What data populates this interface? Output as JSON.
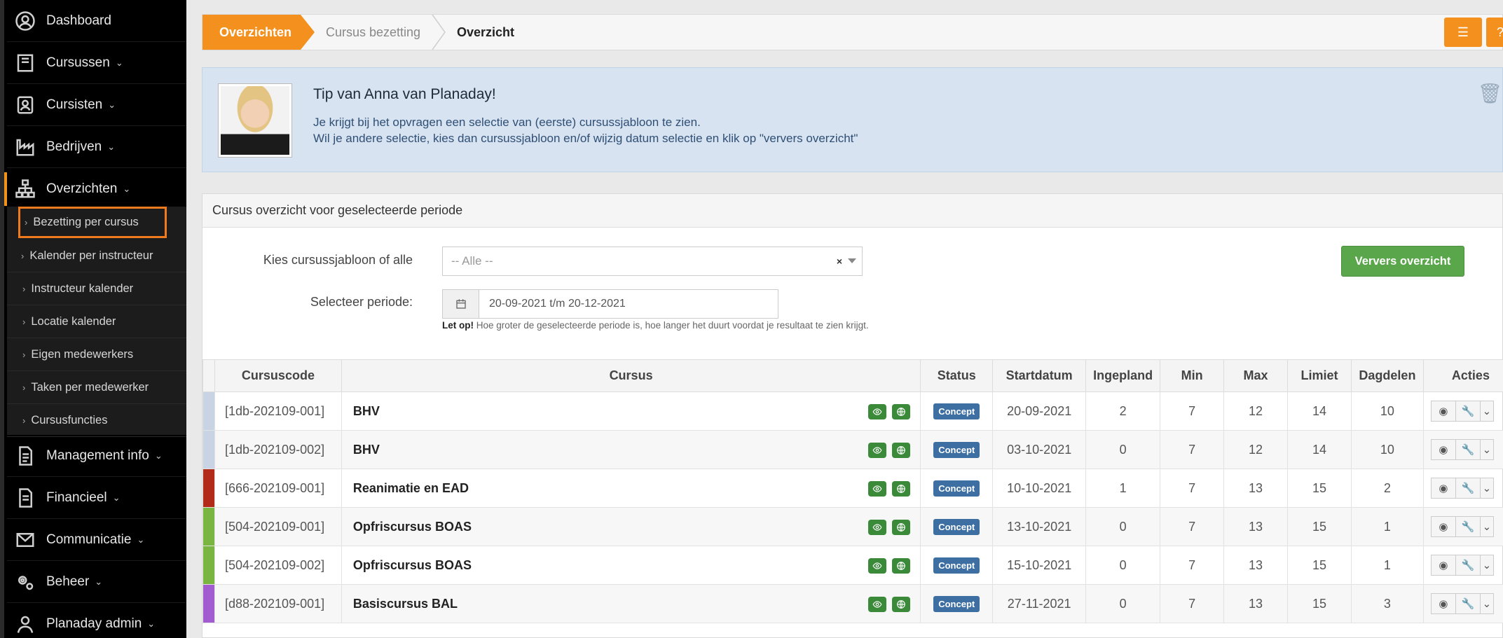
{
  "sidebar": {
    "items": [
      {
        "label": "Dashboard",
        "icon": "user-circle-icon",
        "chevron": ""
      },
      {
        "label": "Cursussen",
        "icon": "book-icon",
        "chevron": "⌄"
      },
      {
        "label": "Cursisten",
        "icon": "id-card-icon",
        "chevron": "⌄"
      },
      {
        "label": "Bedrijven",
        "icon": "industry-icon",
        "chevron": "⌄"
      },
      {
        "label": "Overzichten",
        "icon": "sitemap-icon",
        "chevron": "⌄"
      },
      {
        "label": "Management info",
        "icon": "document-icon",
        "chevron": "⌄"
      },
      {
        "label": "Financieel",
        "icon": "document-icon",
        "chevron": "⌄"
      },
      {
        "label": "Communicatie",
        "icon": "envelope-icon",
        "chevron": "⌄"
      },
      {
        "label": "Beheer",
        "icon": "gears-icon",
        "chevron": "⌄"
      },
      {
        "label": "Planaday admin",
        "icon": "admin-icon",
        "chevron": "⌄"
      }
    ],
    "submenu": [
      "Bezetting per cursus",
      "Kalender per instructeur",
      "Instructeur kalender",
      "Locatie kalender",
      "Eigen medewerkers",
      "Taken per medewerker",
      "Cursusfuncties"
    ]
  },
  "breadcrumb": {
    "first": "Overzichten",
    "second": "Cursus bezetting",
    "third": "Overzicht"
  },
  "tip": {
    "title": "Tip van Anna van Planaday!",
    "line1": "Je krijgt bij het opvragen een selectie van (eerste) cursussjabloon te zien.",
    "line2": "Wil je andere selectie, kies dan cursussjabloon en/of wijzig datum selectie en klik op \"ververs overzicht\""
  },
  "panel": {
    "title": "Cursus overzicht voor geselecteerde periode",
    "template_label": "Kies cursussjabloon of alle",
    "template_value": "-- Alle --",
    "period_label": "Selecteer periode:",
    "period_value": "20-09-2021 t/m 20-12-2021",
    "hint_bold": "Let op!",
    "hint_text": " Hoe groter de geselecteerde periode is, hoe langer het duurt voordat je resultaat te zien krijgt.",
    "refresh_button": "Ververs overzicht"
  },
  "table": {
    "headers": {
      "code": "Cursuscode",
      "course": "Cursus",
      "status": "Status",
      "start": "Startdatum",
      "planned": "Ingepland",
      "min": "Min",
      "max": "Max",
      "limit": "Limiet",
      "parts": "Dagdelen",
      "actions": "Acties"
    },
    "rows": [
      {
        "color": "#c8d4e4",
        "code": "[1db-202109-001]",
        "course": "BHV",
        "status": "Concept",
        "start": "20-09-2021",
        "planned": "2",
        "min": "7",
        "max": "12",
        "limit": "14",
        "parts": "10"
      },
      {
        "color": "#c8d4e4",
        "code": "[1db-202109-002]",
        "course": "BHV",
        "status": "Concept",
        "start": "03-10-2021",
        "planned": "0",
        "min": "7",
        "max": "12",
        "limit": "14",
        "parts": "10"
      },
      {
        "color": "#b22a1a",
        "code": "[666-202109-001]",
        "course": "Reanimatie en EAD",
        "status": "Concept",
        "start": "10-10-2021",
        "planned": "1",
        "min": "7",
        "max": "13",
        "limit": "15",
        "parts": "2"
      },
      {
        "color": "#7bb541",
        "code": "[504-202109-001]",
        "course": "Opfriscursus BOAS",
        "status": "Concept",
        "start": "13-10-2021",
        "planned": "0",
        "min": "7",
        "max": "13",
        "limit": "15",
        "parts": "1"
      },
      {
        "color": "#7bb541",
        "code": "[504-202109-002]",
        "course": "Opfriscursus BOAS",
        "status": "Concept",
        "start": "15-10-2021",
        "planned": "0",
        "min": "7",
        "max": "13",
        "limit": "15",
        "parts": "1"
      },
      {
        "color": "#a35bd0",
        "code": "[d88-202109-001]",
        "course": "Basiscursus BAL",
        "status": "Concept",
        "start": "27-11-2021",
        "planned": "0",
        "min": "7",
        "max": "13",
        "limit": "15",
        "parts": "3"
      }
    ]
  }
}
